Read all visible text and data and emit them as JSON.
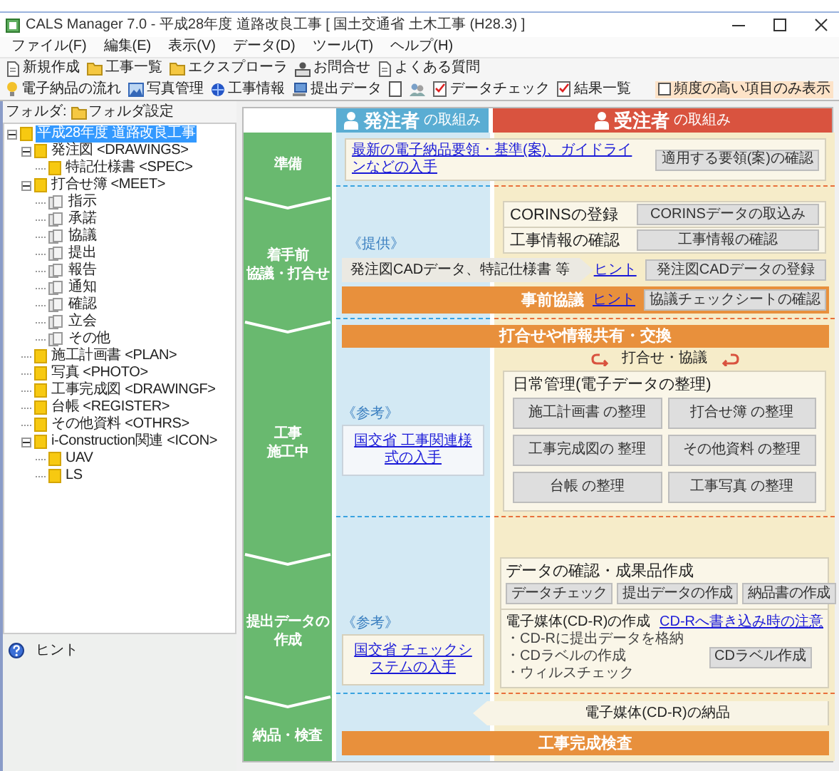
{
  "window": {
    "title": "CALS Manager 7.0 - 平成28年度 道路改良工事 [ 国土交通省 土木工事 (H28.3) ]"
  },
  "menu": [
    "ファイル(F)",
    "編集(E)",
    "表示(V)",
    "データ(D)",
    "ツール(T)",
    "ヘルプ(H)"
  ],
  "toolbar_1": [
    "新規作成",
    "工事一覧",
    "エクスプローラ",
    "お問合せ",
    "よくある質問"
  ],
  "toolbar_2": [
    "電子納品の流れ",
    "写真管理",
    "工事情報",
    "提出データ",
    "データチェック",
    "結果一覧"
  ],
  "filter_checkbox": {
    "label": "頻度の高い項目のみ表示",
    "checked": false
  },
  "folder_panel": {
    "label": "フォルダ:",
    "settings_button": "フォルダ設定",
    "tree": [
      {
        "label": "平成28年度 道路改良工事",
        "kind": "folder",
        "selected": true,
        "expanded": true,
        "children": [
          {
            "label": "発注図 <DRAWINGS>",
            "kind": "folder",
            "selected": false,
            "expanded": true,
            "children": [
              {
                "label": "特記仕様書 <SPEC>",
                "kind": "folder",
                "selected": false
              }
            ]
          },
          {
            "label": "打合せ簿 <MEET>",
            "kind": "folder",
            "selected": false,
            "expanded": true,
            "children": [
              {
                "label": "指示",
                "kind": "document",
                "selected": false
              },
              {
                "label": "承諾",
                "kind": "document",
                "selected": false
              },
              {
                "label": "協議",
                "kind": "document",
                "selected": false
              },
              {
                "label": "提出",
                "kind": "document",
                "selected": false
              },
              {
                "label": "報告",
                "kind": "document",
                "selected": false
              },
              {
                "label": "通知",
                "kind": "document",
                "selected": false
              },
              {
                "label": "確認",
                "kind": "document",
                "selected": false
              },
              {
                "label": "立会",
                "kind": "document",
                "selected": false
              },
              {
                "label": "その他",
                "kind": "document",
                "selected": false
              }
            ]
          },
          {
            "label": "施工計画書 <PLAN>",
            "kind": "folder",
            "selected": false
          },
          {
            "label": "写真 <PHOTO>",
            "kind": "folder",
            "selected": false
          },
          {
            "label": "工事完成図 <DRAWINGF>",
            "kind": "folder",
            "selected": false
          },
          {
            "label": "台帳 <REGISTER>",
            "kind": "folder",
            "selected": false
          },
          {
            "label": "その他資料 <OTHRS>",
            "kind": "folder",
            "selected": false
          },
          {
            "label": "i-Construction関連 <ICON>",
            "kind": "folder",
            "selected": false,
            "expanded": true,
            "children": [
              {
                "label": "UAV",
                "kind": "folder",
                "selected": false
              },
              {
                "label": "LS",
                "kind": "folder",
                "selected": false
              }
            ]
          }
        ]
      }
    ]
  },
  "hint_panel": {
    "label": "ヒント"
  },
  "flow": {
    "headers": [
      {
        "role": "発注者",
        "suffix": "の取組み"
      },
      {
        "role": "受注者",
        "suffix": "の取組み"
      }
    ],
    "stage_titles": [
      [
        "準備"
      ],
      [
        "着手前",
        "協議・打合せ"
      ],
      [
        "工事",
        "施工中"
      ],
      [
        "提出データの",
        "作成"
      ],
      [
        "納品・検査"
      ]
    ],
    "preparation": {
      "link": "最新の電子納品要領・基準(案)、ガイドラインなどの入手",
      "button": "適用する要領(案)の確認"
    },
    "pre_start": {
      "provided_label": "《提供》",
      "provided_items": "発注図CADデータ、特記仕様書 等",
      "checks": [
        {
          "label": "CORINSの登録",
          "button": "CORINSデータの取込み"
        },
        {
          "label": "工事情報の確認",
          "button": "工事情報の確認"
        }
      ],
      "hint_link": "ヒント",
      "register_button": "発注図CADデータの登録",
      "consultation": {
        "title": "事前協議",
        "hint_link": "ヒント",
        "button": "協議チェックシートの確認"
      }
    },
    "construction": {
      "banner": "打合せや情報共有・交換",
      "meeting_label": "打合せ・協議",
      "reference_label": "《参考》",
      "reference_link": "国交省 工事関連様式の入手",
      "daily": {
        "title": "日常管理(電子データの整理)",
        "buttons": [
          "施工計画書 の整理",
          "打合せ簿 の整理",
          "工事完成図の 整理",
          "その他資料 の整理",
          "台帳 の整理",
          "工事写真 の整理"
        ]
      }
    },
    "submission": {
      "reference_label": "《参考》",
      "reference_link": "国交省 チェックシステムの入手",
      "check": {
        "title": "データの確認・成果品作成",
        "buttons": [
          "データチェック",
          "提出データの作成",
          "納品書の作成"
        ]
      },
      "media": {
        "title": "電子媒体(CD-R)の作成",
        "bullets": [
          "・CD-Rに提出データを格納",
          "・CDラベルの作成",
          "・ウィルスチェック"
        ],
        "link": "CD-Rへ書き込み時の注意",
        "button": "CDラベル作成"
      }
    },
    "delivery": {
      "media_delivery": "電子媒体(CD-R)の納品",
      "inspection": "工事完成検査"
    }
  }
}
